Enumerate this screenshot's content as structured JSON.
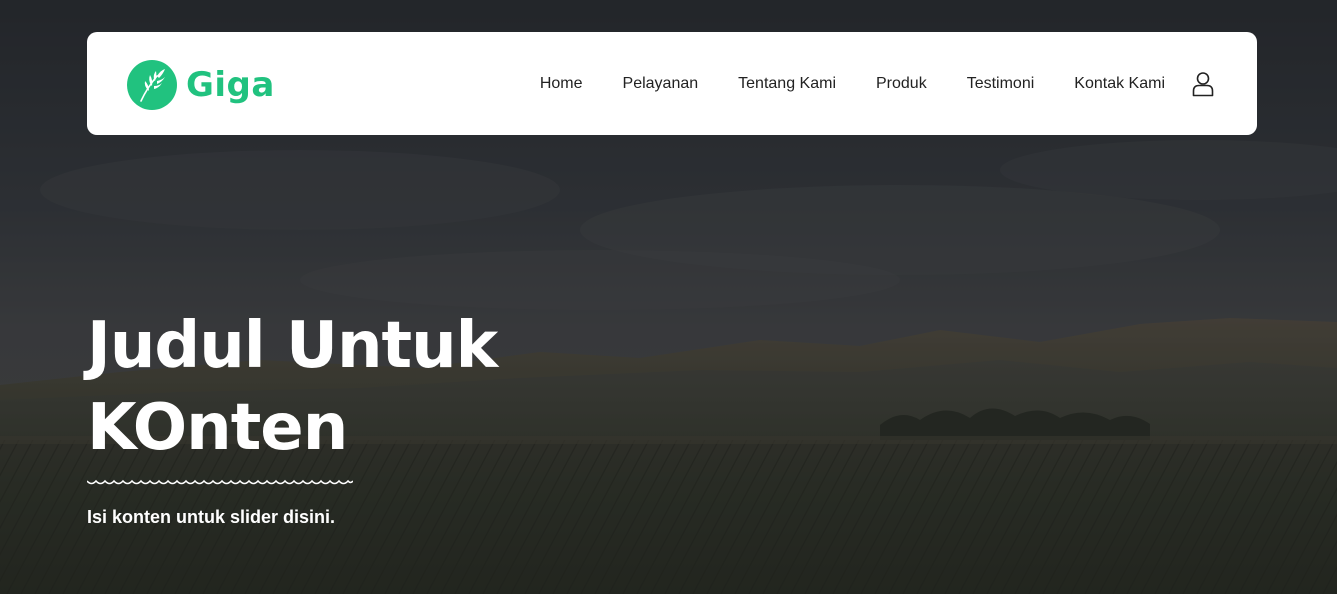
{
  "brand": {
    "name": "Giga",
    "icon": "leaf-wheat-icon",
    "color": "#21c27f"
  },
  "nav": {
    "items": [
      {
        "label": "Home"
      },
      {
        "label": "Pelayanan"
      },
      {
        "label": "Tentang Kami"
      },
      {
        "label": "Produk"
      },
      {
        "label": "Testimoni"
      },
      {
        "label": "Kontak Kami"
      }
    ],
    "user_icon": "user-icon"
  },
  "hero": {
    "title_line1": "Judul Untuk",
    "title_line2": "KOnten",
    "subtitle": "Isi konten untuk slider disini.",
    "background": "dark farmland field with mountains under cloudy sky"
  }
}
